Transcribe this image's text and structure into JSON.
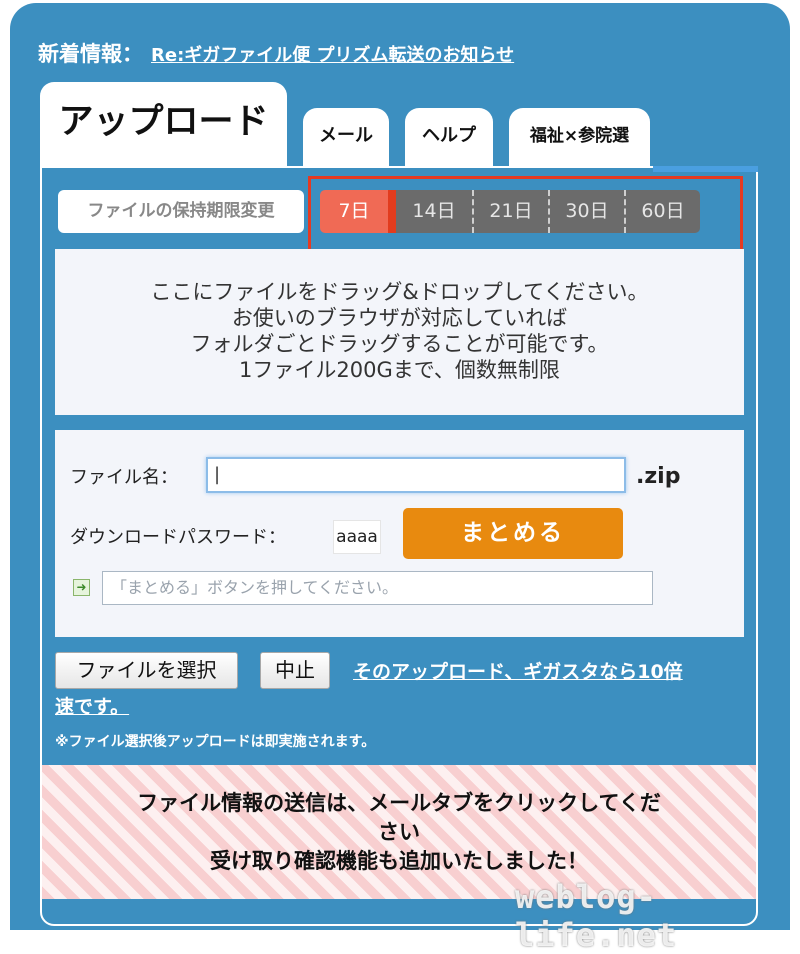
{
  "news": {
    "label": "新着情報：",
    "link": "Re:ギガファイル便 プリズム転送のお知らせ"
  },
  "tabs": [
    "アップロード",
    "メール",
    "ヘルプ",
    "福祉×参院選"
  ],
  "retention": {
    "button_label": "ファイルの保持期限変更",
    "options": [
      "7日",
      "14日",
      "21日",
      "30日",
      "60日"
    ],
    "selected": "7日"
  },
  "dropzone": {
    "lines": [
      "ここにファイルをドラッグ&ドロップしてください。",
      "お使いのブラウザが対応していれば",
      "フォルダごとドラッグすることが可能です。",
      "1ファイル200Gまで、個数無制限"
    ]
  },
  "form": {
    "filename_label": "ファイル名：",
    "filename_value": "|",
    "extension": ".zip",
    "password_label": "ダウンロードパスワード：",
    "password_value": "aaaa",
    "bundle_button": "まとめる",
    "status_placeholder": "「まとめる」ボタンを押してください。"
  },
  "actions": {
    "select_button": "ファイルを選択",
    "cancel_button": "中止",
    "promo_line1": "そのアップロード、ギガスタなら10倍",
    "promo_line2": "速です。",
    "note": "※ファイル選択後アップロードは即実施されます。"
  },
  "banner": {
    "line1": "ファイル情報の送信は、メールタブをクリックしてくだ",
    "line2": "さい",
    "line3": "受け取り確認機能も追加いたしました！"
  },
  "watermark": "weblog-life.net",
  "colors": {
    "frame_blue": "#3c8fc0",
    "accent_orange": "#e88a0f",
    "selected_red": "#f06a55",
    "highlight_box": "#e53a22"
  }
}
